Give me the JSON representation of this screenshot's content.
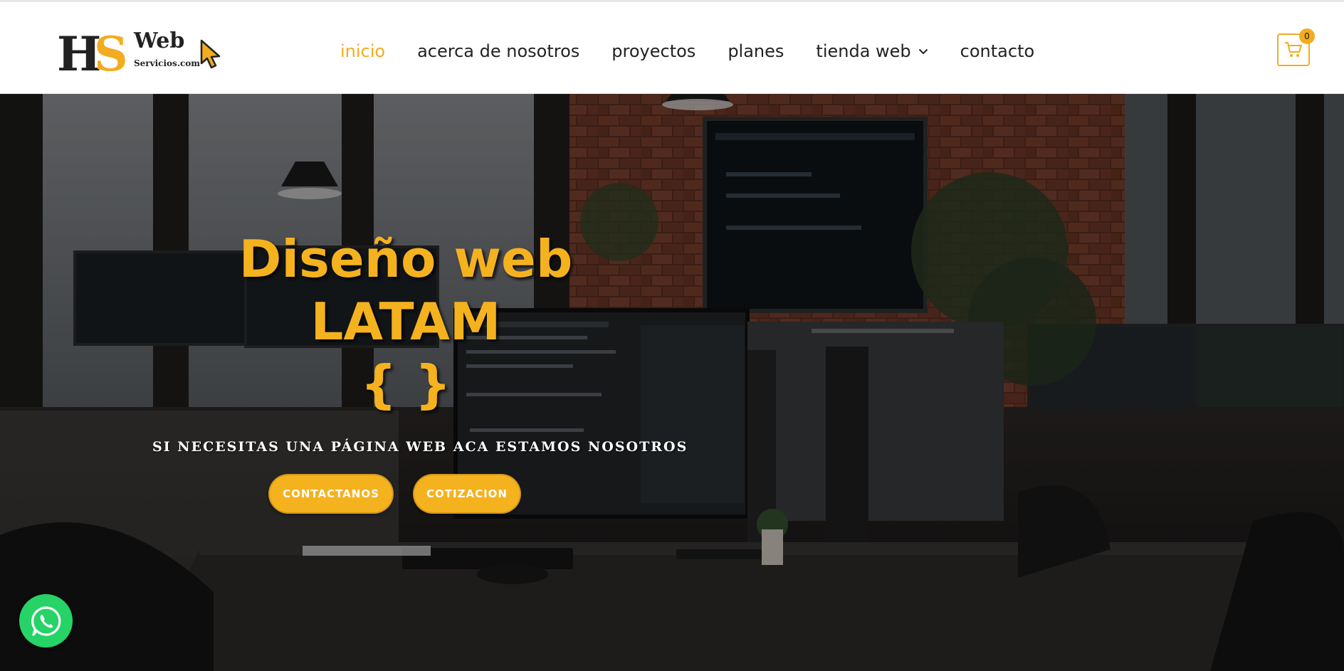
{
  "brand": {
    "logo_initials_h": "H",
    "logo_initials_s": "S",
    "logo_word": "Web",
    "logo_domain": "Servicios.com",
    "accent_color": "#f2ac1f",
    "dark_color": "#222222"
  },
  "nav": {
    "items": [
      {
        "label": "inicio",
        "active": true
      },
      {
        "label": "acerca de nosotros",
        "active": false
      },
      {
        "label": "proyectos",
        "active": false
      },
      {
        "label": "planes",
        "active": false
      },
      {
        "label": "tienda web",
        "active": false,
        "has_dropdown": true,
        "icon": "chevron-down-icon"
      },
      {
        "label": "contacto",
        "active": false
      }
    ]
  },
  "cart": {
    "icon": "cart-icon",
    "count": "0"
  },
  "hero": {
    "title_line1": "Diseño web",
    "title_line2": "LATAM",
    "title_line3": "{ }",
    "subtitle": "SI NECESITAS UNA PÁGINA WEB ACA ESTAMOS NOSOTROS",
    "primary_button": "CONTACTANOS",
    "secondary_button": "COTIZACION",
    "title_color": "#f5b21f",
    "button_color": "#f5b21f"
  },
  "floating": {
    "whatsapp_icon": "whatsapp-icon",
    "whatsapp_color": "#25d366"
  }
}
